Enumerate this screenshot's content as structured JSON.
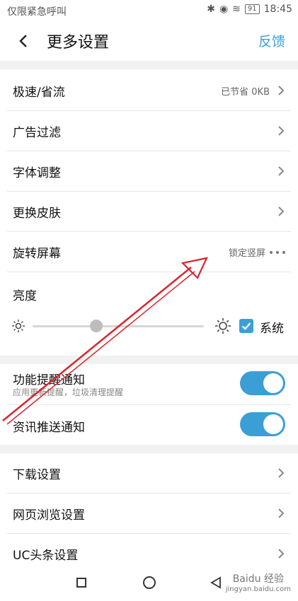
{
  "statusbar": {
    "left_text": "仅限紧急呼叫",
    "battery": "91",
    "time": "18:45"
  },
  "topbar": {
    "title": "更多设置",
    "feedback": "反馈"
  },
  "settings": {
    "speed": {
      "label": "极速/省流",
      "value": "已节省 0KB"
    },
    "ads": {
      "label": "广告过滤"
    },
    "font": {
      "label": "字体调整"
    },
    "skin": {
      "label": "更换皮肤"
    },
    "rotate": {
      "label": "旋转屏幕",
      "value": "锁定竖屏"
    },
    "brightness": {
      "label": "亮度",
      "level": 0.37,
      "system_label": "系统",
      "system_checked": true
    },
    "reminders": {
      "label": "功能提醒通知",
      "sublabel": "应用更新提醒，垃圾清理提醒",
      "enabled": true
    },
    "news_push": {
      "label": "资讯推送通知",
      "enabled": true
    },
    "download": {
      "label": "下载设置"
    },
    "browse": {
      "label": "网页浏览设置"
    },
    "headlines": {
      "label": "UC头条设置"
    }
  },
  "watermark": {
    "text": "Baidu 经验",
    "sub": "jingyan.baidu.com"
  },
  "colors": {
    "accent": "#3b9fd6",
    "annotation_arrow": "#d6262c"
  }
}
